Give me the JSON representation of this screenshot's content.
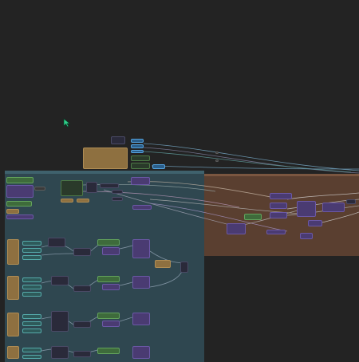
{
  "canvas": {
    "background": "#232323",
    "cursor_icon": "pointer-cursor-icon",
    "groups": [
      {
        "name": "node-group-teal",
        "color": "#2f4750"
      },
      {
        "name": "node-group-brown",
        "color": "#5a3f30"
      }
    ]
  }
}
